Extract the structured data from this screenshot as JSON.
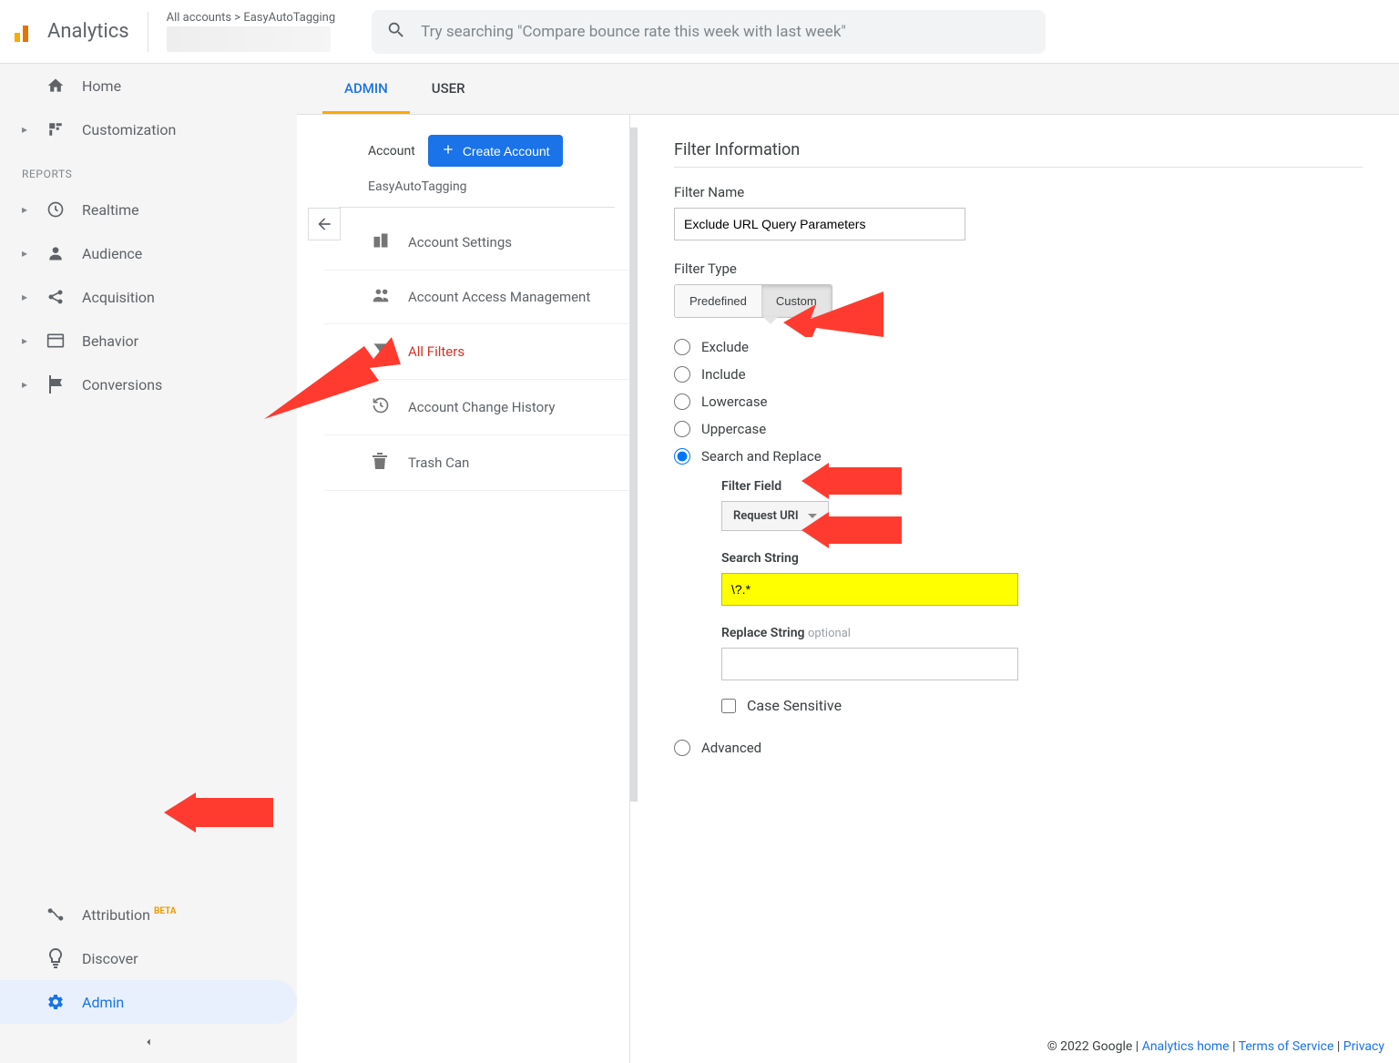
{
  "header": {
    "product": "Analytics",
    "breadcrumb": "All accounts > EasyAutoTagging",
    "search_placeholder": "Try searching \"Compare bounce rate this week with last week\""
  },
  "sidebar": {
    "home": "Home",
    "customization": "Customization",
    "reports_label": "REPORTS",
    "realtime": "Realtime",
    "audience": "Audience",
    "acquisition": "Acquisition",
    "behavior": "Behavior",
    "conversions": "Conversions",
    "attribution": "Attribution",
    "attribution_badge": "BETA",
    "discover": "Discover",
    "admin": "Admin"
  },
  "tabs": {
    "admin": "ADMIN",
    "user": "USER"
  },
  "account_col": {
    "label": "Account",
    "create_button": "Create Account",
    "account_name": "EasyAutoTagging",
    "items": {
      "settings": "Account Settings",
      "access": "Account Access Management",
      "filters": "All Filters",
      "history": "Account Change History",
      "trash": "Trash Can"
    }
  },
  "form": {
    "section_title": "Filter Information",
    "name_label": "Filter Name",
    "name_value": "Exclude URL Query Parameters",
    "type_label": "Filter Type",
    "toggle_predefined": "Predefined",
    "toggle_custom": "Custom",
    "radio_exclude": "Exclude",
    "radio_include": "Include",
    "radio_lowercase": "Lowercase",
    "radio_uppercase": "Uppercase",
    "radio_search_replace": "Search and Replace",
    "radio_advanced": "Advanced",
    "field_label": "Filter Field",
    "field_value": "Request URI",
    "search_label": "Search String",
    "search_value": "\\?.*",
    "replace_label": "Replace String",
    "replace_optional": "optional",
    "case_sensitive": "Case Sensitive"
  },
  "footer": {
    "copyright": "© 2022 Google",
    "analytics_home": "Analytics home",
    "terms": "Terms of Service",
    "privacy": "Privacy"
  }
}
